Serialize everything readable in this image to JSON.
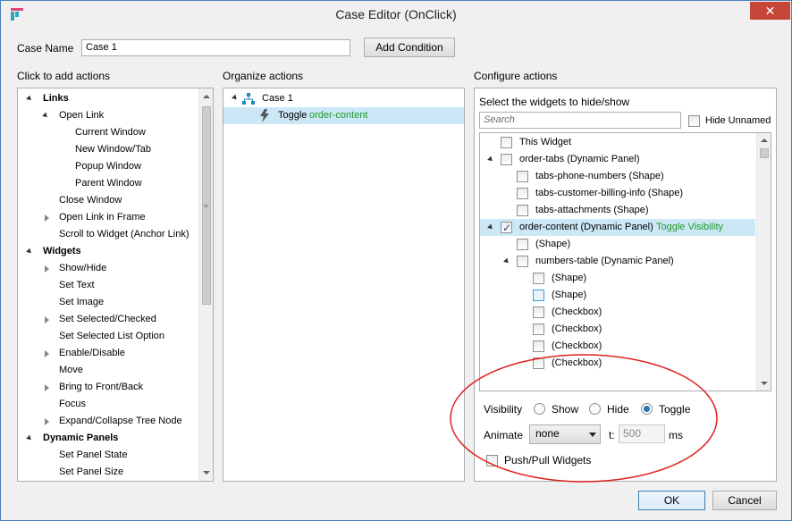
{
  "window": {
    "title": "Case Editor (OnClick)",
    "close_glyph": "✕"
  },
  "top": {
    "case_name_label": "Case Name",
    "case_name_value": "Case 1",
    "add_condition_label": "Add Condition"
  },
  "left": {
    "heading": "Click to add actions",
    "items": [
      {
        "label": "Links",
        "level": 0,
        "bold": true,
        "expander": "open"
      },
      {
        "label": "Open Link",
        "level": 1,
        "expander": "open"
      },
      {
        "label": "Current Window",
        "level": 2
      },
      {
        "label": "New Window/Tab",
        "level": 2
      },
      {
        "label": "Popup Window",
        "level": 2
      },
      {
        "label": "Parent Window",
        "level": 2
      },
      {
        "label": "Close Window",
        "level": 1
      },
      {
        "label": "Open Link in Frame",
        "level": 1,
        "expander": "closed"
      },
      {
        "label": "Scroll to Widget (Anchor Link)",
        "level": 1
      },
      {
        "label": "Widgets",
        "level": 0,
        "bold": true,
        "expander": "open"
      },
      {
        "label": "Show/Hide",
        "level": 1,
        "expander": "closed"
      },
      {
        "label": "Set Text",
        "level": 1
      },
      {
        "label": "Set Image",
        "level": 1
      },
      {
        "label": "Set Selected/Checked",
        "level": 1,
        "expander": "closed"
      },
      {
        "label": "Set Selected List Option",
        "level": 1
      },
      {
        "label": "Enable/Disable",
        "level": 1,
        "expander": "closed"
      },
      {
        "label": "Move",
        "level": 1
      },
      {
        "label": "Bring to Front/Back",
        "level": 1,
        "expander": "closed"
      },
      {
        "label": "Focus",
        "level": 1
      },
      {
        "label": "Expand/Collapse Tree Node",
        "level": 1,
        "expander": "closed"
      },
      {
        "label": "Dynamic Panels",
        "level": 0,
        "bold": true,
        "expander": "open"
      },
      {
        "label": "Set Panel State",
        "level": 1
      },
      {
        "label": "Set Panel Size",
        "level": 1
      }
    ],
    "scroll_fraction": 0.0
  },
  "middle": {
    "heading": "Organize actions",
    "case_label": "Case 1",
    "action_verb": "Toggle",
    "action_target": "order-content"
  },
  "right": {
    "heading": "Configure actions",
    "subheading": "Select the widgets to hide/show",
    "search_placeholder": "Search",
    "hide_unnamed_label": "Hide Unnamed",
    "widgets": [
      {
        "label": "This Widget",
        "level": 0,
        "checked": false
      },
      {
        "label": "order-tabs (Dynamic Panel)",
        "level": 0,
        "checked": false,
        "expander": "open"
      },
      {
        "label": "tabs-phone-numbers (Shape)",
        "level": 1,
        "checked": false
      },
      {
        "label": "tabs-customer-billing-info (Shape)",
        "level": 1,
        "checked": false
      },
      {
        "label": "tabs-attachments (Shape)",
        "level": 1,
        "checked": false
      },
      {
        "label": "order-content (Dynamic Panel)",
        "level": 0,
        "checked": true,
        "expander": "open",
        "selected": true,
        "note": "Toggle Visibility"
      },
      {
        "label": "(Shape)",
        "level": 1,
        "checked": false
      },
      {
        "label": "numbers-table (Dynamic Panel)",
        "level": 1,
        "checked": false,
        "expander": "open"
      },
      {
        "label": "(Shape)",
        "level": 2,
        "checked": false
      },
      {
        "label": "(Shape)",
        "level": 2,
        "checked": false,
        "highlight": true
      },
      {
        "label": "(Checkbox)",
        "level": 2,
        "checked": false
      },
      {
        "label": "(Checkbox)",
        "level": 2,
        "checked": false
      },
      {
        "label": "(Checkbox)",
        "level": 2,
        "checked": false
      },
      {
        "label": "(Checkbox)",
        "level": 2,
        "checked": false
      }
    ],
    "visibility_label": "Visibility",
    "visibility_options": [
      "Show",
      "Hide",
      "Toggle"
    ],
    "visibility_selected": "Toggle",
    "animate_label": "Animate",
    "animate_value": "none",
    "t_label": "t:",
    "t_value": "500",
    "ms_label": "ms",
    "push_pull_label": "Push/Pull Widgets"
  },
  "footer": {
    "ok_label": "OK",
    "cancel_label": "Cancel"
  },
  "colors": {
    "accent_green": "#1f9b2a",
    "selection": "#cce8f6",
    "close": "#c7463a",
    "annotation": "#e0211c"
  }
}
